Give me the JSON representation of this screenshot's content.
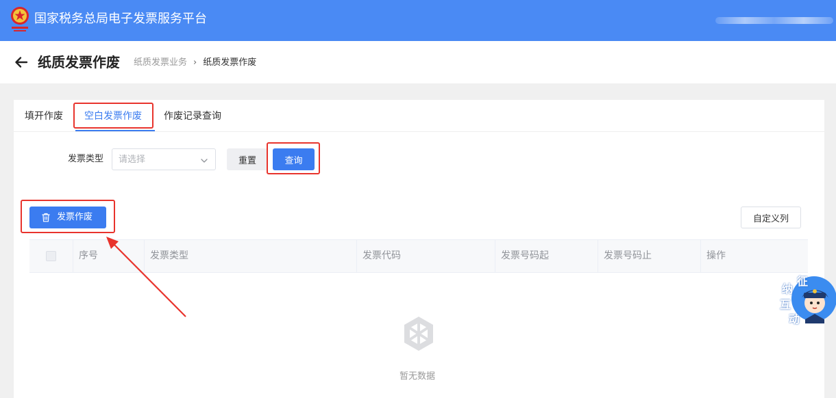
{
  "header": {
    "app_title": "国家税务总局电子发票服务平台"
  },
  "page": {
    "title": "纸质发票作废",
    "breadcrumb": [
      "纸质发票业务",
      "纸质发票作废"
    ]
  },
  "tabs": [
    {
      "label": "填开作废",
      "active": false
    },
    {
      "label": "空白发票作废",
      "active": true
    },
    {
      "label": "作废记录查询",
      "active": false
    }
  ],
  "filter": {
    "invoice_type_label": "发票类型",
    "invoice_type_placeholder": "请选择",
    "reset_label": "重置",
    "query_label": "查询"
  },
  "toolbar": {
    "void_label": "发票作废",
    "custom_columns_label": "自定义列"
  },
  "table": {
    "columns": [
      "序号",
      "发票类型",
      "发票代码",
      "发票号码起",
      "发票号码止",
      "操作"
    ],
    "rows": [],
    "empty_text": "暂无数据"
  },
  "floating": {
    "characters": [
      "征",
      "纳",
      "互",
      "动"
    ]
  },
  "colors": {
    "header_bg": "#4a8af4",
    "primary": "#3b7cf0",
    "annotation": "#e8332c"
  }
}
